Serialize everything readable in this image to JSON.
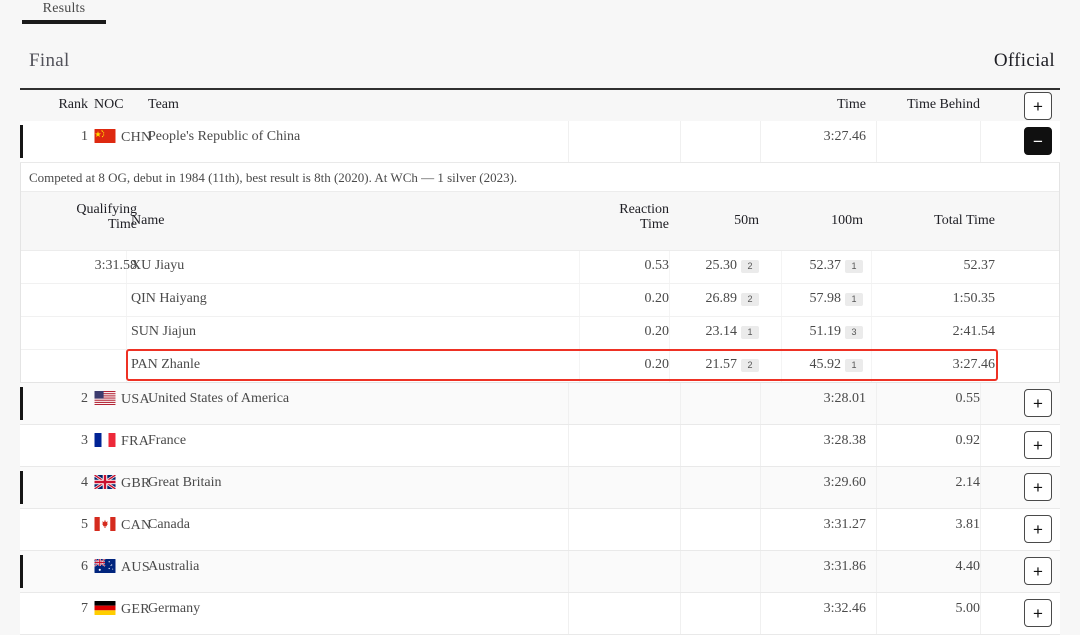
{
  "tab": {
    "label": "Results"
  },
  "section": {
    "title": "Final",
    "status": "Official"
  },
  "table": {
    "headers": {
      "rank": "Rank",
      "noc": "NOC",
      "team": "Team",
      "time": "Time",
      "time_behind": "Time Behind",
      "expand_all": "+"
    },
    "rows": [
      {
        "rank": "1",
        "noc": "CHN",
        "flag": "cn",
        "team": "People's Republic of China",
        "time": "3:27.46",
        "behind": "",
        "button": "−",
        "expanded": true
      },
      {
        "rank": "2",
        "noc": "USA",
        "flag": "us",
        "team": "United States of America",
        "time": "3:28.01",
        "behind": "0.55",
        "button": "+",
        "expanded": false
      },
      {
        "rank": "3",
        "noc": "FRA",
        "flag": "fr",
        "team": "France",
        "time": "3:28.38",
        "behind": "0.92",
        "button": "+",
        "expanded": false
      },
      {
        "rank": "4",
        "noc": "GBR",
        "flag": "gb",
        "team": "Great Britain",
        "time": "3:29.60",
        "behind": "2.14",
        "button": "+",
        "expanded": false
      },
      {
        "rank": "5",
        "noc": "CAN",
        "flag": "ca",
        "team": "Canada",
        "time": "3:31.27",
        "behind": "3.81",
        "button": "+",
        "expanded": false
      },
      {
        "rank": "6",
        "noc": "AUS",
        "flag": "au",
        "team": "Australia",
        "time": "3:31.86",
        "behind": "4.40",
        "button": "+",
        "expanded": false
      },
      {
        "rank": "7",
        "noc": "GER",
        "flag": "de",
        "team": "Germany",
        "time": "3:32.46",
        "behind": "5.00",
        "button": "+",
        "expanded": false
      }
    ]
  },
  "detail": {
    "note": "Competed at 8 OG, debut in 1984 (11th), best result is 8th (2020). At WCh — 1 silver (2023).",
    "headers": {
      "qualifying_time": "Qualifying Time",
      "qualifying_time_l1": "Qualifying",
      "qualifying_time_l2": "Time",
      "name": "Name",
      "reaction_time_l1": "Reaction",
      "reaction_time_l2": "Time",
      "fifty": "50m",
      "hundred": "100m",
      "total_time": "Total Time"
    },
    "athletes": [
      {
        "qualifying": "3:31.58",
        "name": "XU Jiayu",
        "reaction": "0.53",
        "split50": "25.30",
        "rank50": "2",
        "split100": "52.37",
        "rank100": "1",
        "total": "52.37",
        "highlighted": false
      },
      {
        "qualifying": "",
        "name": "QIN Haiyang",
        "reaction": "0.20",
        "split50": "26.89",
        "rank50": "2",
        "split100": "57.98",
        "rank100": "1",
        "total": "1:50.35",
        "highlighted": false
      },
      {
        "qualifying": "",
        "name": "SUN Jiajun",
        "reaction": "0.20",
        "split50": "23.14",
        "rank50": "1",
        "split100": "51.19",
        "rank100": "3",
        "total": "2:41.54",
        "highlighted": false
      },
      {
        "qualifying": "",
        "name": "PAN Zhanle",
        "reaction": "0.20",
        "split50": "21.57",
        "rank50": "2",
        "split100": "45.92",
        "rank100": "1",
        "total": "3:27.46",
        "highlighted": true
      }
    ]
  },
  "colors": {
    "highlight": "#ee3124",
    "accent_dark": "#151515",
    "page_bg": "#f7f7f7"
  }
}
